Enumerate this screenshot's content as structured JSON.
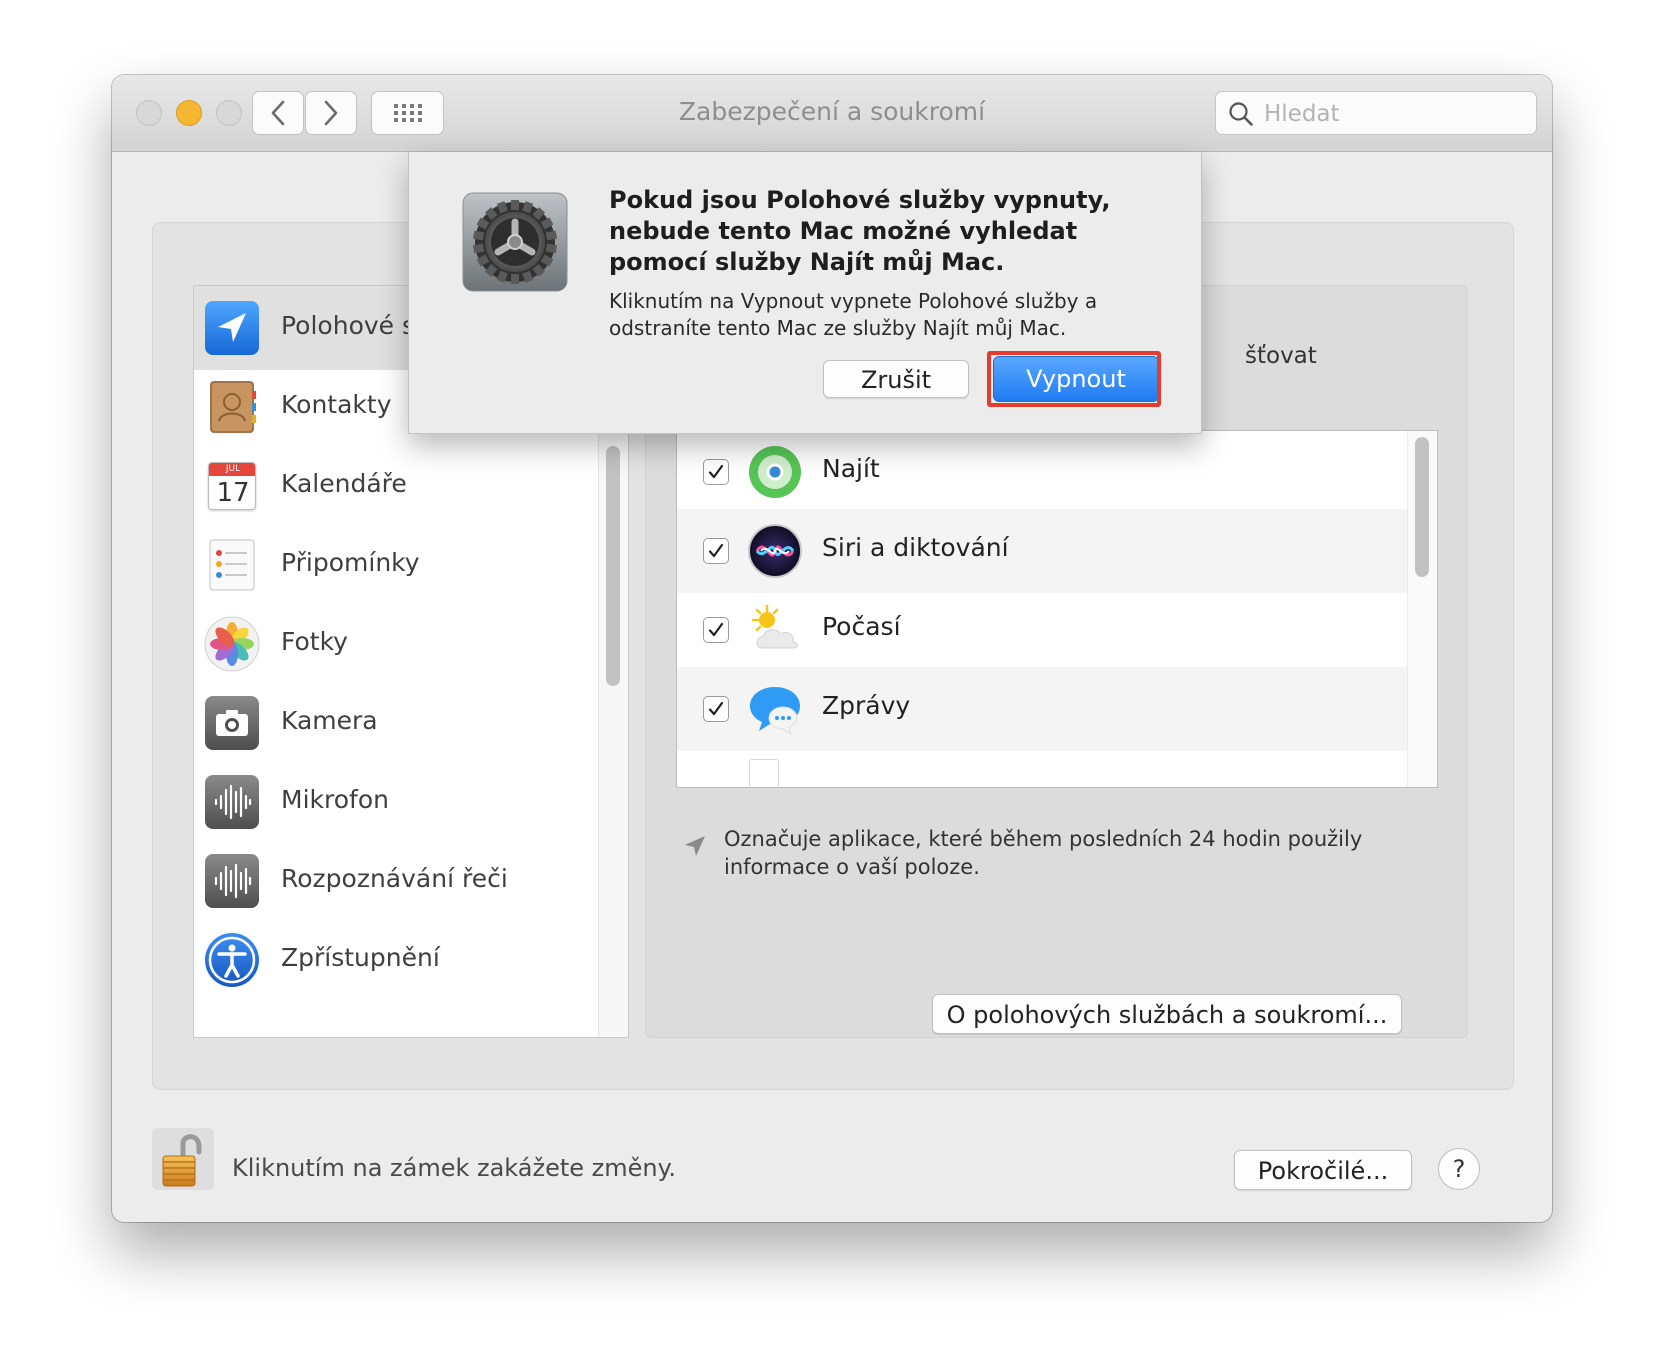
{
  "window": {
    "title": "Zabezpečení a soukromí",
    "search_placeholder": "Hledat"
  },
  "sidebar": {
    "items": [
      {
        "label": "Polohové s",
        "icon": "location-arrow-icon",
        "selected": true
      },
      {
        "label": "Kontakty",
        "icon": "contacts-icon"
      },
      {
        "label": "Kalendáře",
        "icon": "calendar-icon",
        "badge_month": "JUL",
        "badge_day": "17"
      },
      {
        "label": "Připomínky",
        "icon": "reminders-icon"
      },
      {
        "label": "Fotky",
        "icon": "photos-icon"
      },
      {
        "label": "Kamera",
        "icon": "camera-icon"
      },
      {
        "label": "Mikrofon",
        "icon": "microphone-icon"
      },
      {
        "label": "Rozpoznávání řeči",
        "icon": "speech-recognition-icon"
      },
      {
        "label": "Zpřístupnění",
        "icon": "accessibility-icon"
      }
    ]
  },
  "main": {
    "allow_partial": "šťovat",
    "apps": [
      {
        "label": "Najít",
        "checked": true,
        "icon": "find-my-icon"
      },
      {
        "label": "Siri a diktování",
        "checked": true,
        "icon": "siri-icon"
      },
      {
        "label": "Počasí",
        "checked": true,
        "icon": "weather-icon"
      },
      {
        "label": "Zprávy",
        "checked": true,
        "icon": "messages-icon"
      }
    ],
    "location_note": "Označuje aplikace, které během posledních 24 hodin použily informace o vaší poloze.",
    "about_button": "O polohových službách a soukromí..."
  },
  "footer": {
    "lock_text": "Kliknutím na zámek zakážete změny.",
    "advanced_button": "Pokročilé...",
    "help_button": "?"
  },
  "alert": {
    "title": "Pokud jsou Polohové služby vypnuty, nebude tento Mac možné vyhledat pomocí služby Najít můj Mac.",
    "message": "Kliknutím na Vypnout vypnete Polohové služby a odstraníte tento Mac ze služby Najít můj Mac.",
    "cancel_button": "Zrušit",
    "confirm_button": "Vypnout",
    "highlight_color": "#e53c30",
    "accent_color": "#1f7bf2"
  }
}
